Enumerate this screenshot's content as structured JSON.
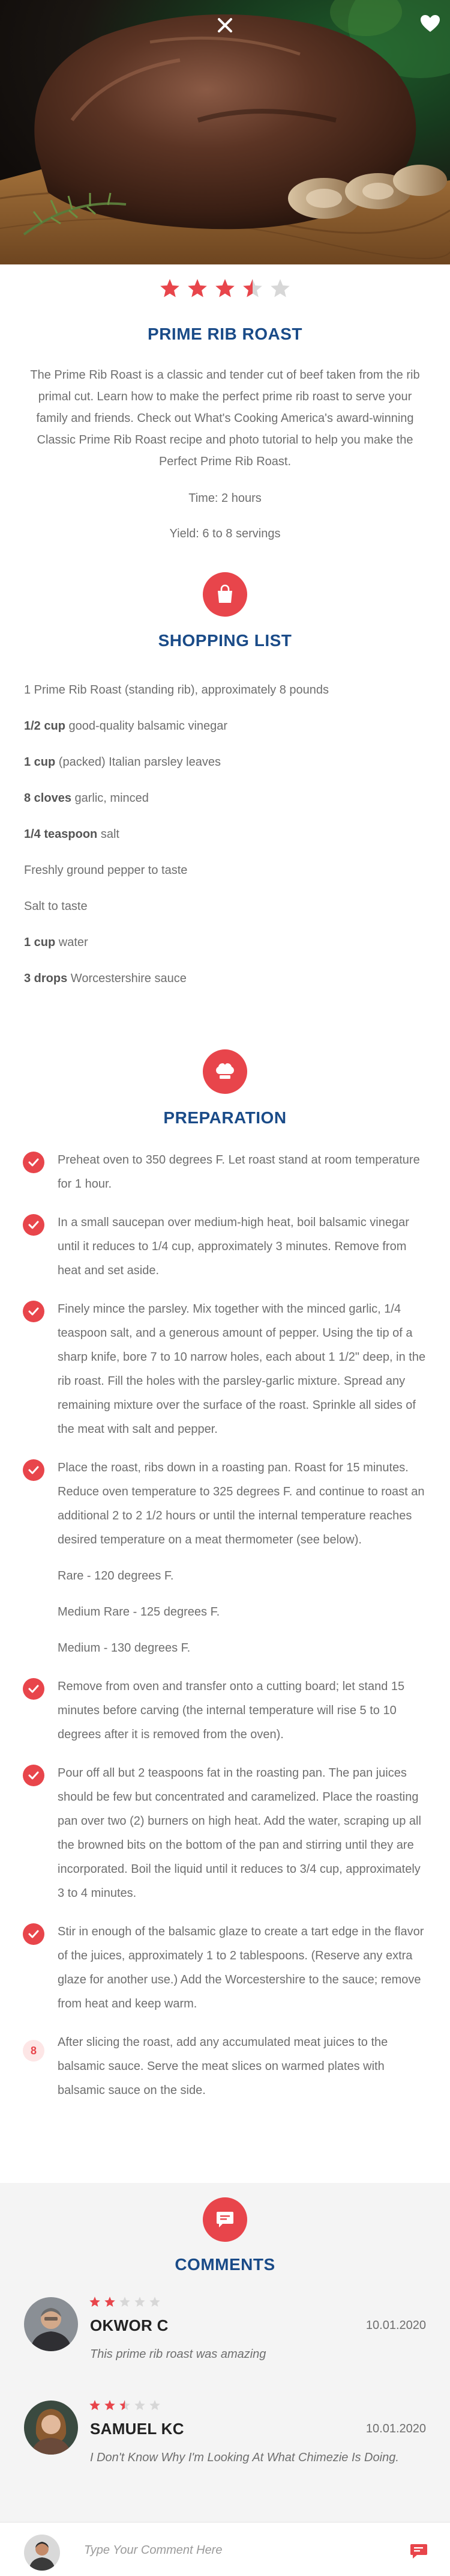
{
  "rating": {
    "value": 3.5,
    "max": 5,
    "colors": {
      "filled": "#e8454b",
      "empty": "#d7d7d7"
    }
  },
  "recipe": {
    "title": "PRIME RIB ROAST",
    "intro": "The Prime Rib Roast is a classic and tender cut of beef taken from the rib primal cut.  Learn how to make the perfect prime rib roast to serve your family and friends.  Check out What's Cooking America's award-winning Classic Prime Rib Roast recipe and photo tutorial to help you make the Perfect Prime Rib Roast.",
    "time": "Time: 2 hours",
    "yield": "Yield: 6 to 8 servings"
  },
  "shopping": {
    "icon": "shopping-bag-icon",
    "title": "SHOPPING LIST",
    "items": [
      {
        "qty": "",
        "text": "1 Prime Rib Roast (standing rib), approximately 8 pounds"
      },
      {
        "qty": "1/2 cup",
        "text": " good-quality balsamic vinegar"
      },
      {
        "qty": "1 cup",
        "text": " (packed) Italian parsley leaves"
      },
      {
        "qty": "8 cloves",
        "text": " garlic, minced"
      },
      {
        "qty": "1/4 teaspoon",
        "text": " salt"
      },
      {
        "qty": "",
        "text": "Freshly ground pepper to taste"
      },
      {
        "qty": "",
        "text": "Salt to taste"
      },
      {
        "qty": "1 cup",
        "text": " water"
      },
      {
        "qty": "3 drops",
        "text": " Worcestershire sauce"
      }
    ]
  },
  "preparation": {
    "icon": "chef-hat-icon",
    "title": "PREPARATION",
    "steps": [
      {
        "done": true,
        "text": "Preheat oven to 350 degrees F.  Let roast stand at room temperature for 1 hour."
      },
      {
        "done": true,
        "text": "In a small saucepan over medium-high heat, boil balsamic vinegar until it reduces to 1/4 cup, approximately 3 minutes.  Remove from heat and set aside."
      },
      {
        "done": true,
        "text": "Finely mince the parsley.  Mix together with the minced garlic, 1/4 teaspoon salt, and a generous amount of pepper.  Using the tip of a sharp knife, bore 7 to 10 narrow holes, each about 1 1/2\" deep, in the rib roast.  Fill the holes with the parsley-garlic mixture.  Spread any remaining mixture over the surface of the roast.  Sprinkle all sides of the meat with salt and pepper."
      },
      {
        "done": true,
        "text": "Place the roast, ribs down in a roasting pan.  Roast for 15 minutes. Reduce oven temperature to 325 degrees F. and continue to roast an additional 2 to 2 1/2 hours or until the internal temperature reaches desired temperature on a meat thermometer (see below).",
        "extra": [
          "Rare - 120 degrees F.",
          "Medium Rare - 125 degrees F.",
          "Medium - 130 degrees F."
        ]
      },
      {
        "done": true,
        "text": "Remove from oven and transfer onto a cutting board; let stand 15 minutes before carving (the internal temperature will rise 5 to 10 degrees after it is removed from the oven)."
      },
      {
        "done": true,
        "text": "Pour off all but 2 teaspoons fat in the roasting pan.  The pan juices should be few but concentrated and caramelized.  Place the roasting pan over two (2) burners on high heat.  Add the water, scraping up all the browned bits on the bottom of the pan and stirring until they are incorporated.  Boil the liquid until it reduces to 3/4 cup, approximately 3 to 4 minutes."
      },
      {
        "done": true,
        "text": "Stir in enough of the balsamic glaze to create a tart edge in the flavor of the juices, approximately 1 to 2 tablespoons.  (Reserve any extra glaze for another use.) Add the Worcestershire to the sauce; remove from heat and keep warm."
      },
      {
        "done": false,
        "number": "8",
        "text": "After slicing the roast, add any accumulated meat juices to the balsamic sauce.  Serve the meat slices on warmed plates with balsamic sauce on the side."
      }
    ]
  },
  "comments": {
    "icon": "comment-icon",
    "title": "COMMENTS",
    "items": [
      {
        "name": "OKWOR C",
        "date": "10.01.2020",
        "rating": 2,
        "text": "This prime rib roast was amazing"
      },
      {
        "name": "SAMUEL KC",
        "date": "10.01.2020",
        "rating": 2.5,
        "text": "I Don't Know Why I'm Looking At What Chimezie Is Doing."
      }
    ]
  },
  "composer": {
    "placeholder": "Type Your Comment Here",
    "send_icon": "send-message-icon"
  },
  "hero": {
    "close_icon": "close-icon",
    "favorite_icon": "heart-icon"
  },
  "theme": {
    "accent": "#e8454b",
    "title_blue": "#1a4b88",
    "comment_bg": "#f4f4f4"
  }
}
